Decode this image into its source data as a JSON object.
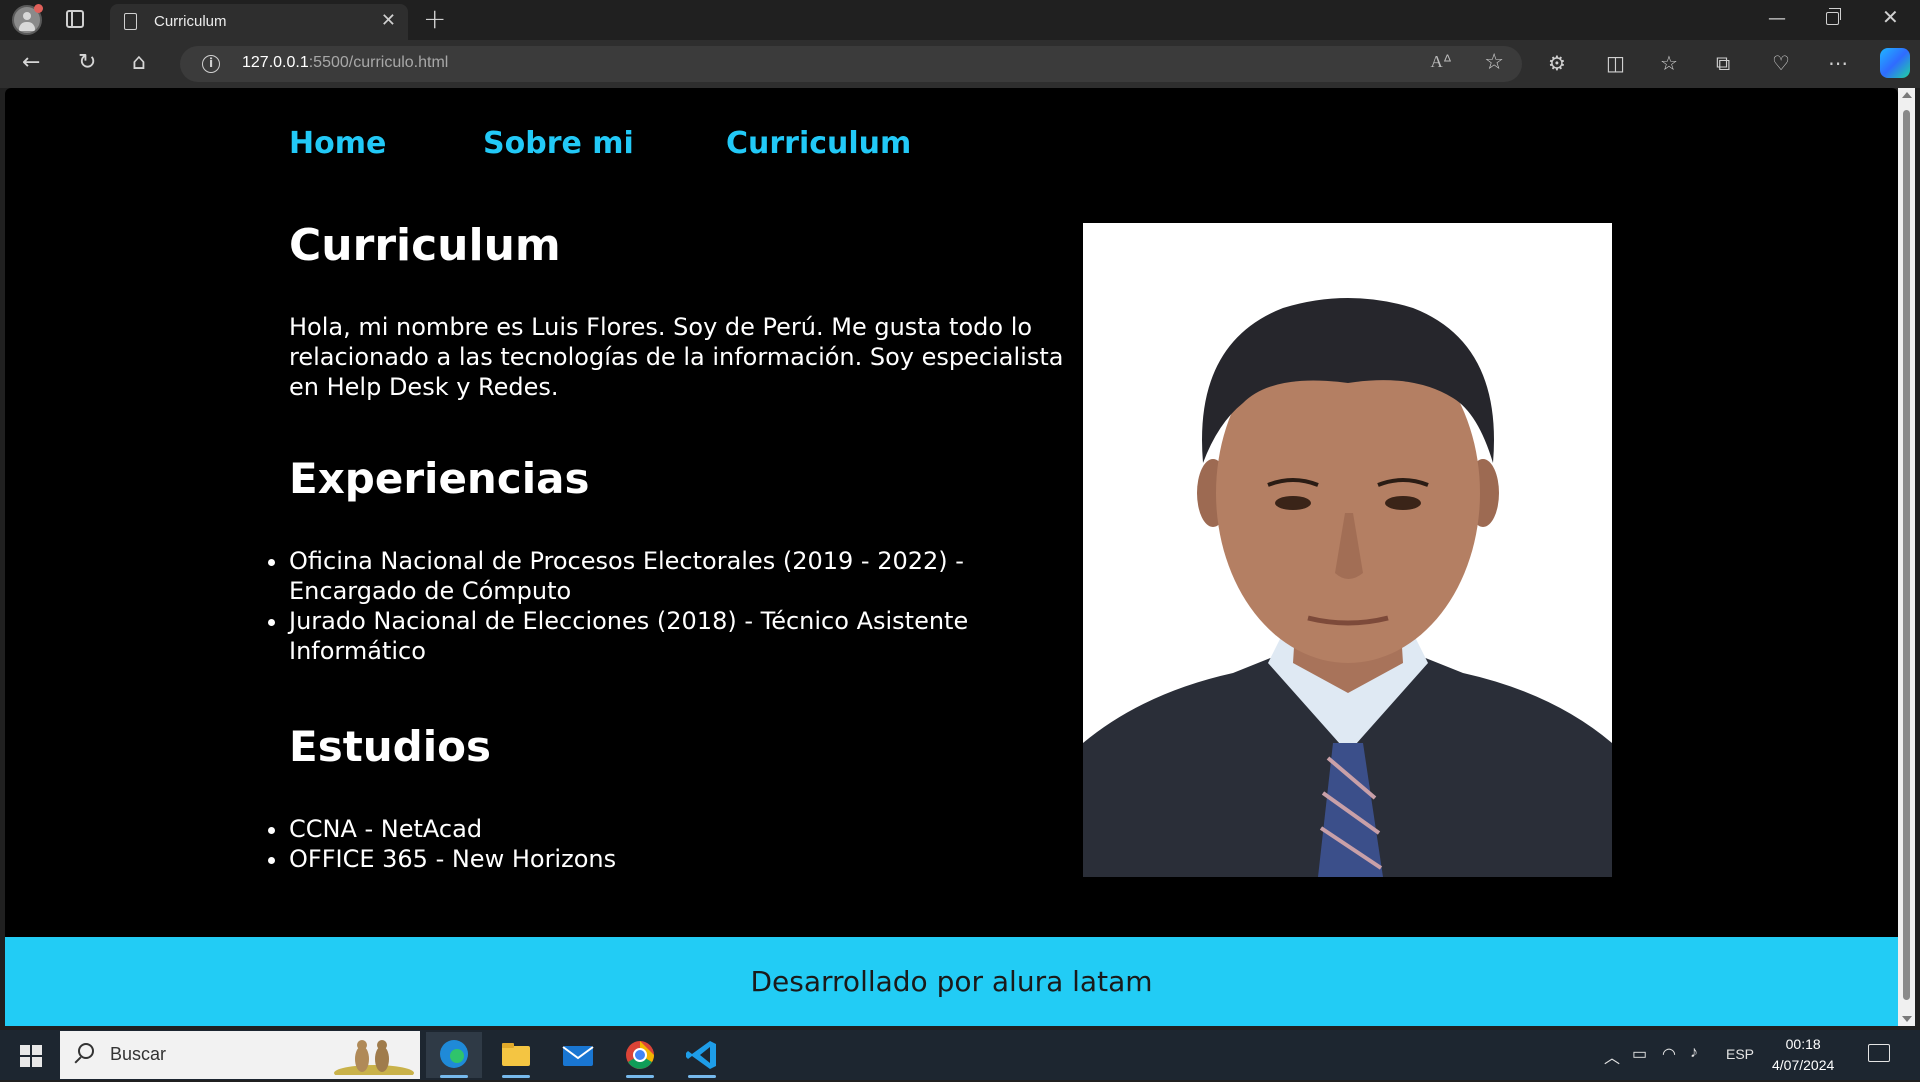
{
  "browser": {
    "tab_title": "Curriculum",
    "url_host": "127.0.0.1",
    "url_path": ":5500/curriculo.html"
  },
  "page": {
    "nav": [
      "Home",
      "Sobre mi",
      "Curriculum"
    ],
    "title": "Curriculum",
    "intro": "Hola, mi nombre es Luis Flores. Soy de Perú. Me gusta todo lo relacionado a las tecnologías de la información. Soy especialista en Help Desk y Redes.",
    "experience_heading": "Experiencias",
    "experience": [
      "Oficina Nacional de Procesos Electorales (2019 - 2022) - Encargado de Cómputo",
      "Jurado Nacional de Elecciones (2018) - Técnico Asistente Informático"
    ],
    "studies_heading": "Estudios",
    "studies": [
      "CCNA - NetAcad",
      "OFFICE 365 - New Horizons"
    ],
    "footer": "Desarrollado por alura latam"
  },
  "colors": {
    "accent": "#22c9f7",
    "footer_bg": "#22ccf5",
    "page_bg": "#000000"
  },
  "taskbar": {
    "search_placeholder": "Buscar",
    "language": "ESP",
    "time": "00:18",
    "date": "4/07/2024"
  }
}
